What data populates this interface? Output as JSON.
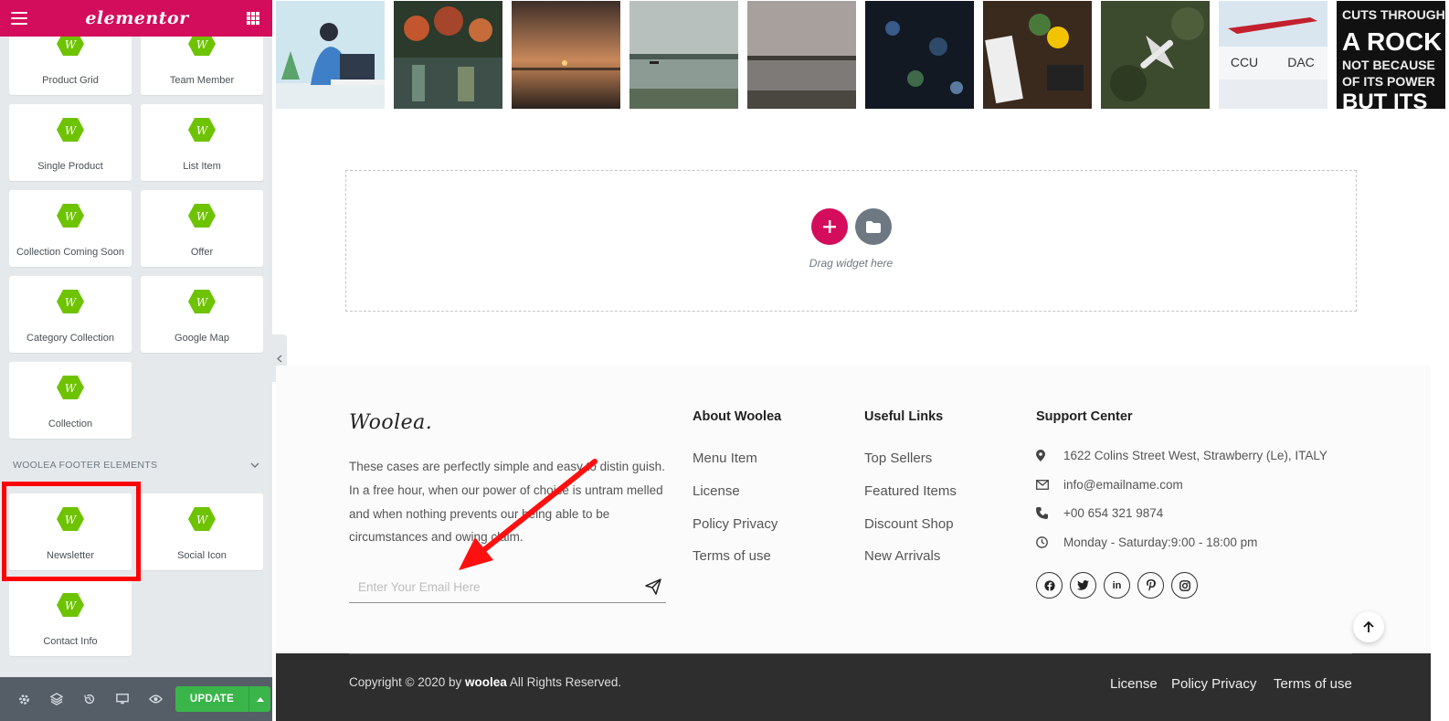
{
  "sidebar": {
    "logo": "elementor",
    "widgets": [
      {
        "label": "Product Grid"
      },
      {
        "label": "Team Member"
      },
      {
        "label": "Single Product"
      },
      {
        "label": "List Item"
      },
      {
        "label": "Collection Coming Soon"
      },
      {
        "label": "Offer"
      },
      {
        "label": "Category Collection"
      },
      {
        "label": "Google Map"
      },
      {
        "label": "Collection"
      }
    ],
    "category_title": "WOOLEA FOOTER ELEMENTS",
    "footer_widgets": [
      {
        "label": "Newsletter"
      },
      {
        "label": "Social Icon"
      },
      {
        "label": "Contact Info"
      }
    ],
    "update_label": "UPDATE"
  },
  "canvas": {
    "drag_text": "Drag widget here"
  },
  "footer": {
    "logo": "Woolea.",
    "description": "These cases are perfectly simple and easy to distin guish. In a free hour, when our power of choice is untram melled and when nothing prevents our being able to be circumstances and owing claim.",
    "email_placeholder": "Enter Your Email Here",
    "about": {
      "title": "About Woolea",
      "links": [
        "Menu Item",
        "License",
        "Policy Privacy",
        "Terms of use"
      ]
    },
    "useful": {
      "title": "Useful Links",
      "links": [
        "Top Sellers",
        "Featured Items",
        "Discount Shop",
        "New Arrivals"
      ]
    },
    "support": {
      "title": "Support Center",
      "address": "1622 Colins Street West, Strawberry (Le), ITALY",
      "email": "info@emailname.com",
      "phone": "+00 654 321 9874",
      "hours": "Monday - Saturday:9:00 - 18:00 pm"
    },
    "social": {
      "linkedin": "in"
    }
  },
  "bottom": {
    "copyright_prefix": "Copyright © 2020 by",
    "copyright_brand": "woolea",
    "copyright_suffix": "All Rights Reserved.",
    "links": [
      "License",
      "Policy Privacy",
      "Terms of use"
    ]
  },
  "colors": {
    "brand": "#d30c5c",
    "widget_icon": "#6ec300",
    "update": "#39b54a",
    "highlight": "#ff0000"
  }
}
